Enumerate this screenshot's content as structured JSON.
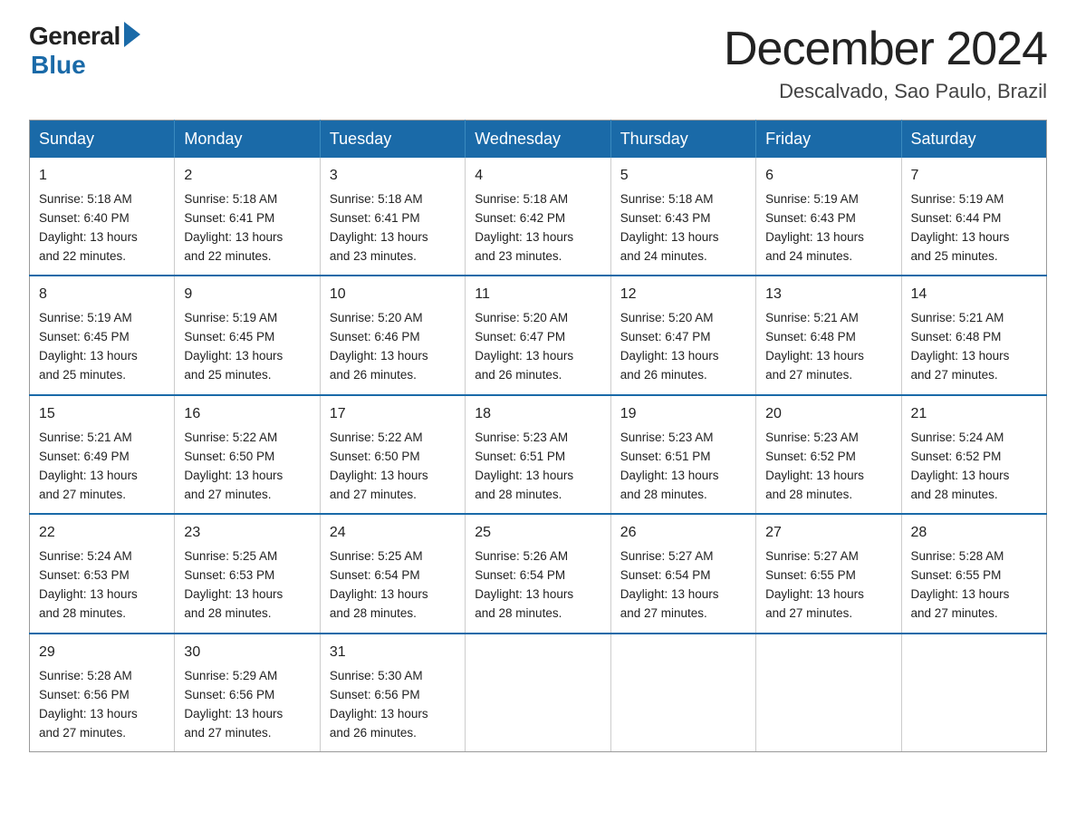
{
  "logo": {
    "general": "General",
    "blue": "Blue"
  },
  "header": {
    "month": "December 2024",
    "location": "Descalvado, Sao Paulo, Brazil"
  },
  "weekdays": [
    "Sunday",
    "Monday",
    "Tuesday",
    "Wednesday",
    "Thursday",
    "Friday",
    "Saturday"
  ],
  "weeks": [
    [
      {
        "day": "1",
        "sunrise": "5:18 AM",
        "sunset": "6:40 PM",
        "daylight": "13 hours and 22 minutes."
      },
      {
        "day": "2",
        "sunrise": "5:18 AM",
        "sunset": "6:41 PM",
        "daylight": "13 hours and 22 minutes."
      },
      {
        "day": "3",
        "sunrise": "5:18 AM",
        "sunset": "6:41 PM",
        "daylight": "13 hours and 23 minutes."
      },
      {
        "day": "4",
        "sunrise": "5:18 AM",
        "sunset": "6:42 PM",
        "daylight": "13 hours and 23 minutes."
      },
      {
        "day": "5",
        "sunrise": "5:18 AM",
        "sunset": "6:43 PM",
        "daylight": "13 hours and 24 minutes."
      },
      {
        "day": "6",
        "sunrise": "5:19 AM",
        "sunset": "6:43 PM",
        "daylight": "13 hours and 24 minutes."
      },
      {
        "day": "7",
        "sunrise": "5:19 AM",
        "sunset": "6:44 PM",
        "daylight": "13 hours and 25 minutes."
      }
    ],
    [
      {
        "day": "8",
        "sunrise": "5:19 AM",
        "sunset": "6:45 PM",
        "daylight": "13 hours and 25 minutes."
      },
      {
        "day": "9",
        "sunrise": "5:19 AM",
        "sunset": "6:45 PM",
        "daylight": "13 hours and 25 minutes."
      },
      {
        "day": "10",
        "sunrise": "5:20 AM",
        "sunset": "6:46 PM",
        "daylight": "13 hours and 26 minutes."
      },
      {
        "day": "11",
        "sunrise": "5:20 AM",
        "sunset": "6:47 PM",
        "daylight": "13 hours and 26 minutes."
      },
      {
        "day": "12",
        "sunrise": "5:20 AM",
        "sunset": "6:47 PM",
        "daylight": "13 hours and 26 minutes."
      },
      {
        "day": "13",
        "sunrise": "5:21 AM",
        "sunset": "6:48 PM",
        "daylight": "13 hours and 27 minutes."
      },
      {
        "day": "14",
        "sunrise": "5:21 AM",
        "sunset": "6:48 PM",
        "daylight": "13 hours and 27 minutes."
      }
    ],
    [
      {
        "day": "15",
        "sunrise": "5:21 AM",
        "sunset": "6:49 PM",
        "daylight": "13 hours and 27 minutes."
      },
      {
        "day": "16",
        "sunrise": "5:22 AM",
        "sunset": "6:50 PM",
        "daylight": "13 hours and 27 minutes."
      },
      {
        "day": "17",
        "sunrise": "5:22 AM",
        "sunset": "6:50 PM",
        "daylight": "13 hours and 27 minutes."
      },
      {
        "day": "18",
        "sunrise": "5:23 AM",
        "sunset": "6:51 PM",
        "daylight": "13 hours and 28 minutes."
      },
      {
        "day": "19",
        "sunrise": "5:23 AM",
        "sunset": "6:51 PM",
        "daylight": "13 hours and 28 minutes."
      },
      {
        "day": "20",
        "sunrise": "5:23 AM",
        "sunset": "6:52 PM",
        "daylight": "13 hours and 28 minutes."
      },
      {
        "day": "21",
        "sunrise": "5:24 AM",
        "sunset": "6:52 PM",
        "daylight": "13 hours and 28 minutes."
      }
    ],
    [
      {
        "day": "22",
        "sunrise": "5:24 AM",
        "sunset": "6:53 PM",
        "daylight": "13 hours and 28 minutes."
      },
      {
        "day": "23",
        "sunrise": "5:25 AM",
        "sunset": "6:53 PM",
        "daylight": "13 hours and 28 minutes."
      },
      {
        "day": "24",
        "sunrise": "5:25 AM",
        "sunset": "6:54 PM",
        "daylight": "13 hours and 28 minutes."
      },
      {
        "day": "25",
        "sunrise": "5:26 AM",
        "sunset": "6:54 PM",
        "daylight": "13 hours and 28 minutes."
      },
      {
        "day": "26",
        "sunrise": "5:27 AM",
        "sunset": "6:54 PM",
        "daylight": "13 hours and 27 minutes."
      },
      {
        "day": "27",
        "sunrise": "5:27 AM",
        "sunset": "6:55 PM",
        "daylight": "13 hours and 27 minutes."
      },
      {
        "day": "28",
        "sunrise": "5:28 AM",
        "sunset": "6:55 PM",
        "daylight": "13 hours and 27 minutes."
      }
    ],
    [
      {
        "day": "29",
        "sunrise": "5:28 AM",
        "sunset": "6:56 PM",
        "daylight": "13 hours and 27 minutes."
      },
      {
        "day": "30",
        "sunrise": "5:29 AM",
        "sunset": "6:56 PM",
        "daylight": "13 hours and 27 minutes."
      },
      {
        "day": "31",
        "sunrise": "5:30 AM",
        "sunset": "6:56 PM",
        "daylight": "13 hours and 26 minutes."
      },
      null,
      null,
      null,
      null
    ]
  ],
  "labels": {
    "sunrise": "Sunrise:",
    "sunset": "Sunset:",
    "daylight": "Daylight:"
  }
}
